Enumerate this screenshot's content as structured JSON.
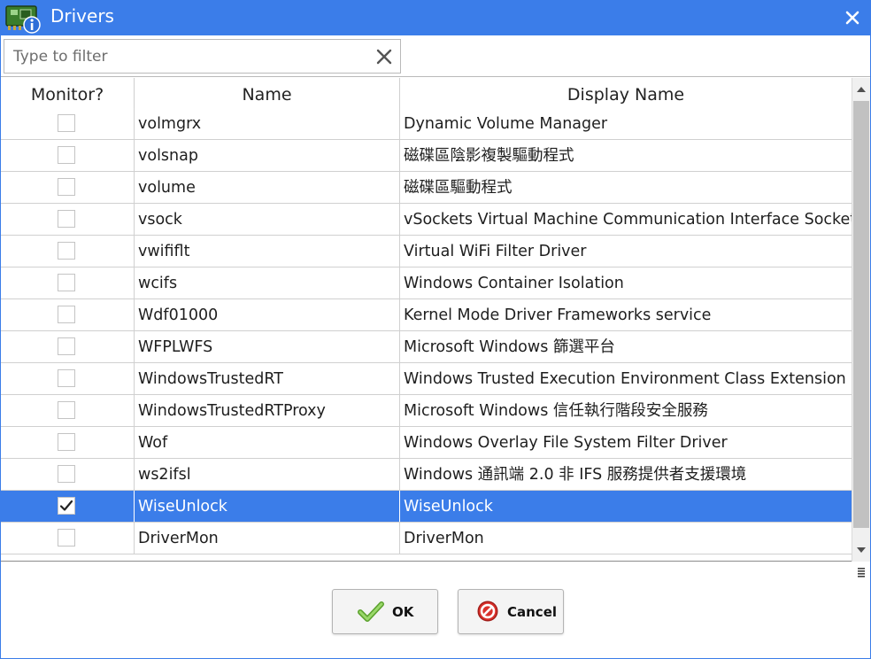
{
  "window": {
    "title": "Drivers"
  },
  "filter": {
    "placeholder": "Type to filter",
    "value": ""
  },
  "columns": {
    "monitor": "Monitor?",
    "name": "Name",
    "display_name": "Display Name"
  },
  "rows": [
    {
      "monitor": false,
      "name": "volmgrx",
      "display_name": "Dynamic Volume Manager"
    },
    {
      "monitor": false,
      "name": "volsnap",
      "display_name": "磁碟區陰影複製驅動程式"
    },
    {
      "monitor": false,
      "name": "volume",
      "display_name": "磁碟區驅動程式"
    },
    {
      "monitor": false,
      "name": "vsock",
      "display_name": "vSockets Virtual Machine Communication Interface Sockets"
    },
    {
      "monitor": false,
      "name": "vwififlt",
      "display_name": "Virtual WiFi Filter Driver"
    },
    {
      "monitor": false,
      "name": "wcifs",
      "display_name": "Windows Container Isolation"
    },
    {
      "monitor": false,
      "name": "Wdf01000",
      "display_name": "Kernel Mode Driver Frameworks service"
    },
    {
      "monitor": false,
      "name": "WFPLWFS",
      "display_name": "Microsoft Windows 篩選平台"
    },
    {
      "monitor": false,
      "name": "WindowsTrustedRT",
      "display_name": "Windows Trusted Execution Environment Class Extension"
    },
    {
      "monitor": false,
      "name": "WindowsTrustedRTProxy",
      "display_name": "Microsoft Windows 信任執行階段安全服務"
    },
    {
      "monitor": false,
      "name": "Wof",
      "display_name": "Windows Overlay File System Filter Driver"
    },
    {
      "monitor": false,
      "name": "ws2ifsl",
      "display_name": "Windows 通訊端 2.0 非 IFS 服務提供者支援環境"
    },
    {
      "monitor": true,
      "name": "WiseUnlock",
      "display_name": "WiseUnlock",
      "selected": true
    },
    {
      "monitor": false,
      "name": "DriverMon",
      "display_name": "DriverMon"
    }
  ],
  "buttons": {
    "ok": "OK",
    "cancel": "Cancel"
  },
  "colors": {
    "accent": "#3b7de9",
    "selection": "#3b7de9",
    "ok_check": "#7cc242",
    "cancel_red": "#d9312b"
  },
  "icons": {
    "app": "drivers-app-icon",
    "close": "close-icon",
    "clear": "clear-filter-icon",
    "ok": "green-check-icon",
    "cancel": "red-no-icon"
  }
}
